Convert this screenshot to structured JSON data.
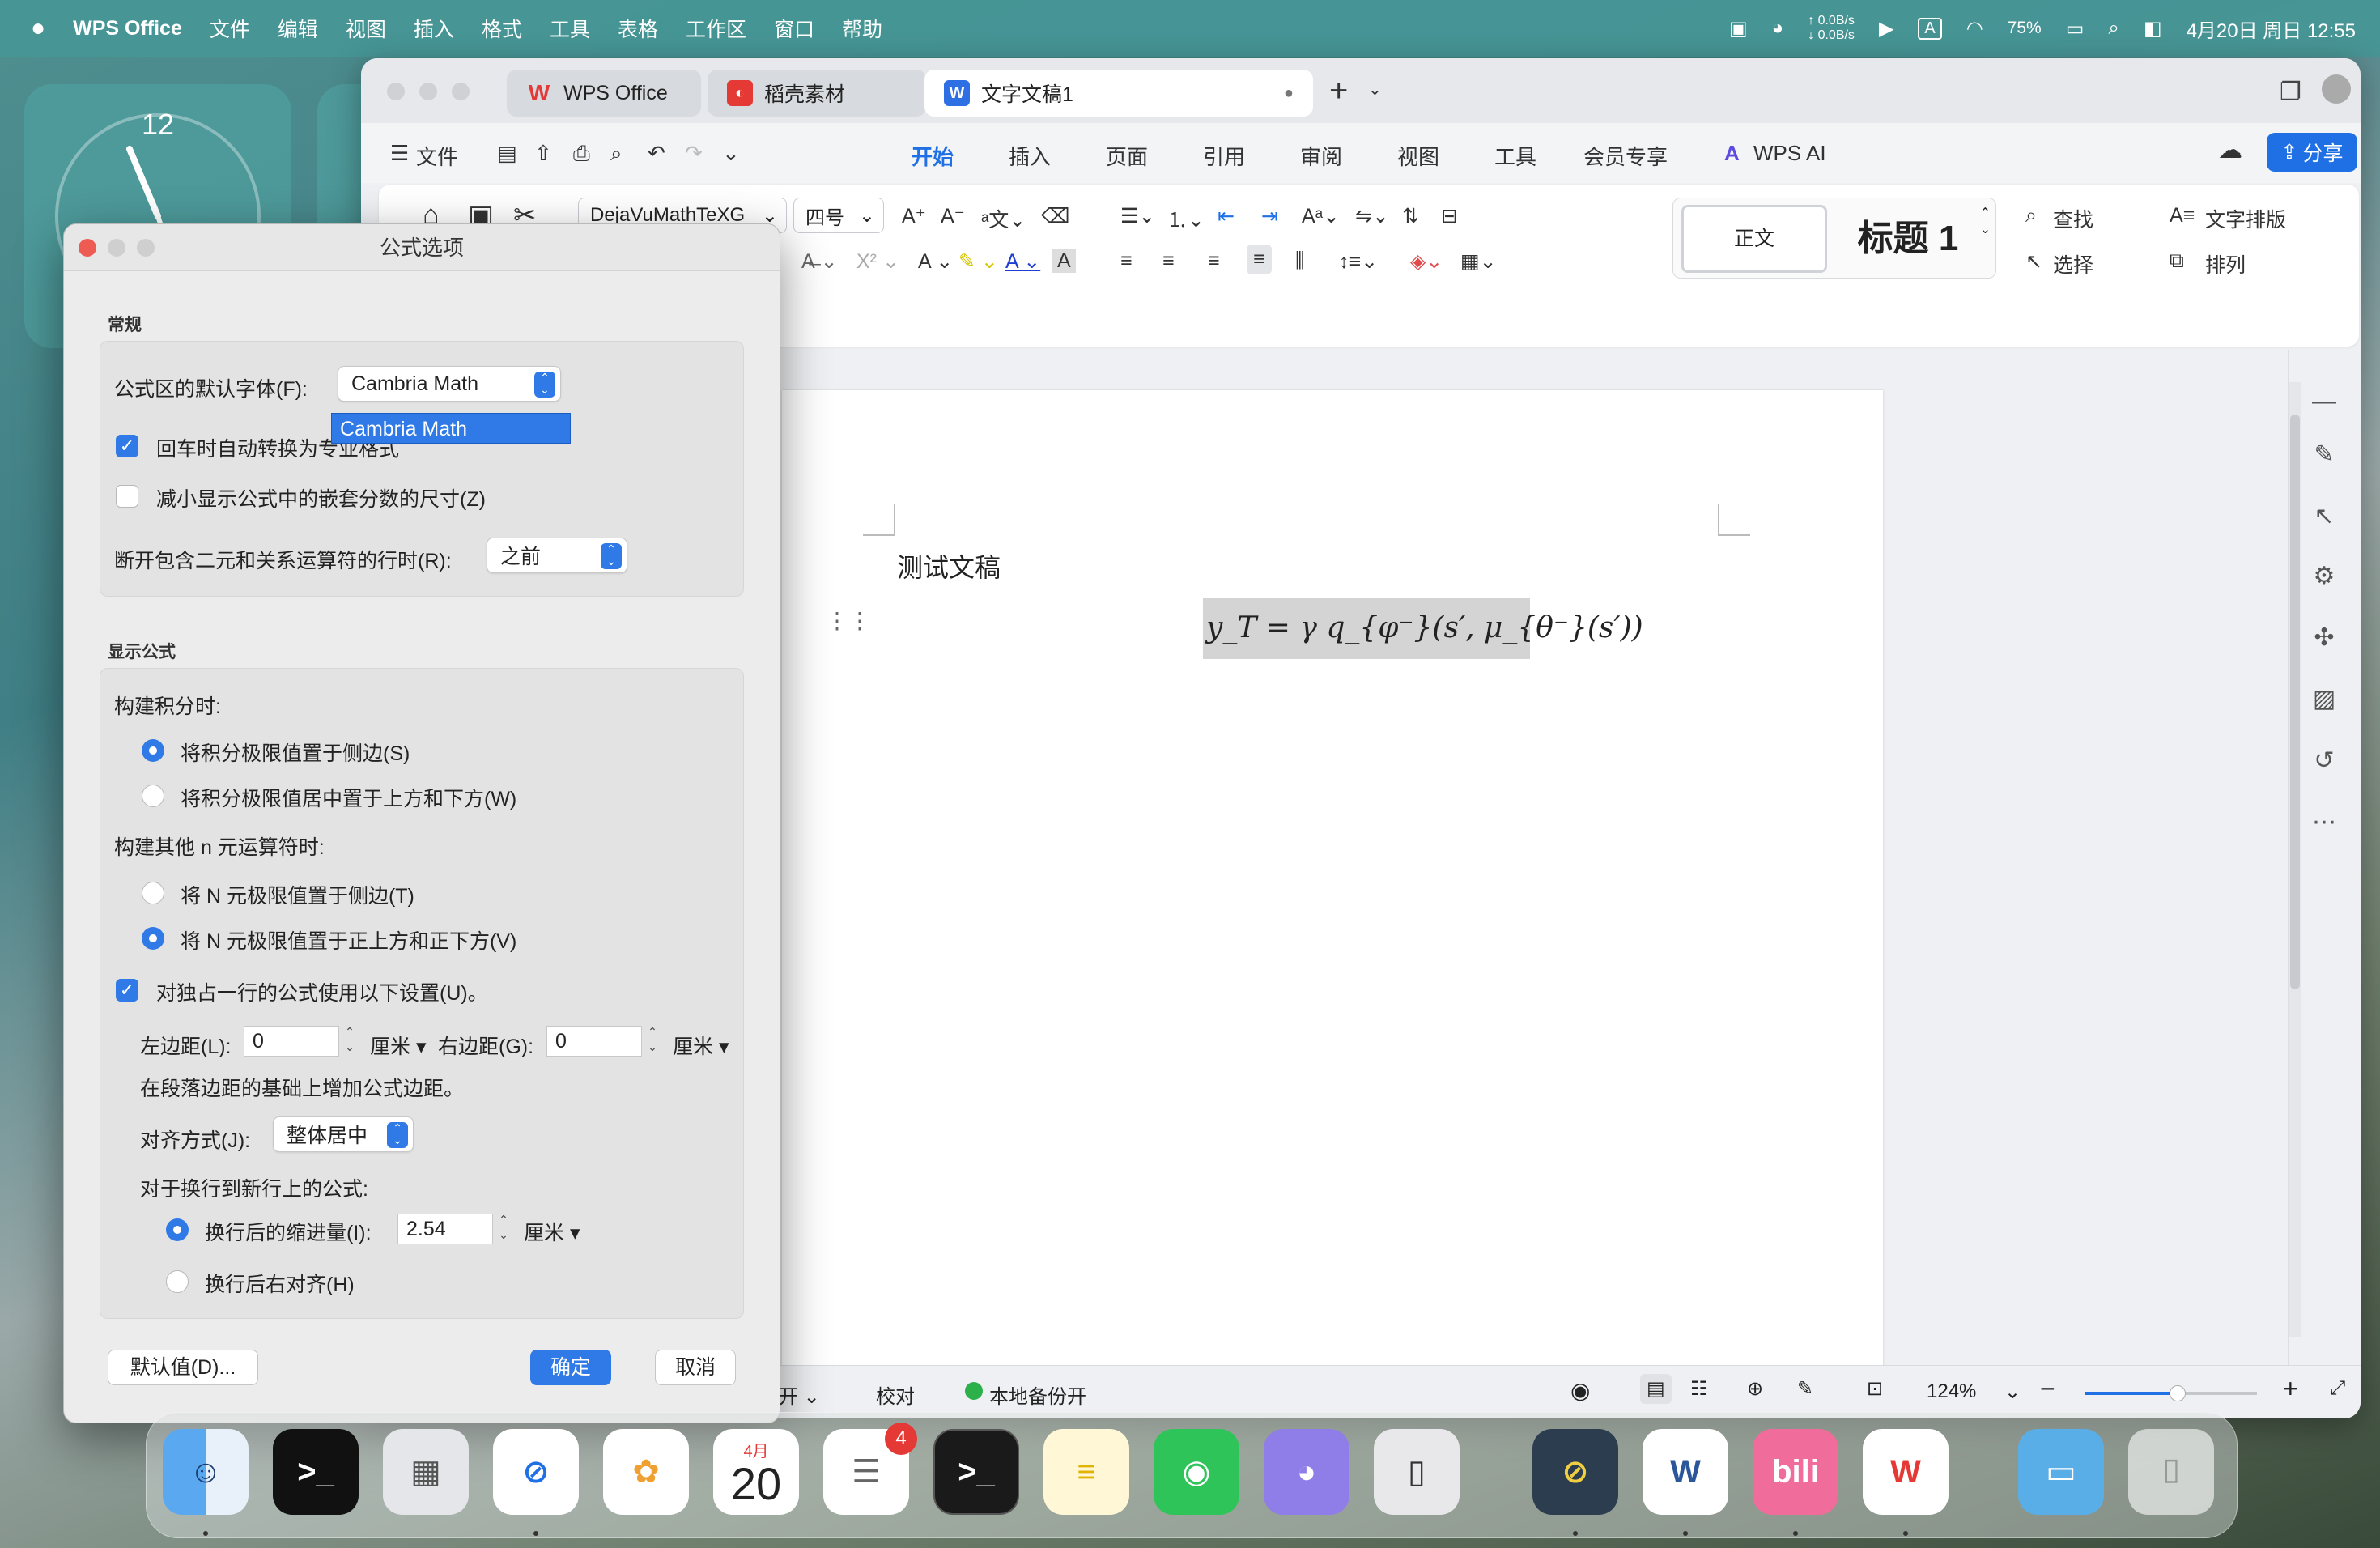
{
  "menubar": {
    "app": "WPS Office",
    "items": [
      "文件",
      "编辑",
      "视图",
      "插入",
      "格式",
      "工具",
      "表格",
      "工作区",
      "窗口",
      "帮助"
    ],
    "net_up": "↑ 0.0B/s",
    "net_down": "↓ 0.0B/s",
    "battery": "75%",
    "datetime": "4月20日 周日 12:55"
  },
  "tabs": [
    {
      "label": "WPS Office"
    },
    {
      "label": "稻壳素材"
    },
    {
      "label": "文字文稿1"
    }
  ],
  "menu_row": {
    "file": "文件",
    "ribbon_tabs": [
      "开始",
      "插入",
      "页面",
      "引用",
      "审阅",
      "视图",
      "工具",
      "会员专享"
    ],
    "wps_ai": "WPS AI",
    "share": "分享"
  },
  "ribbon": {
    "font": "DejaVuMathTeXG",
    "size": "四号",
    "style_normal": "正文",
    "style_heading": "标题 1",
    "find": "查找",
    "select": "选择",
    "text_layout": "文字排版",
    "arrange": "排列"
  },
  "document": {
    "title": "测试文稿",
    "formula": "y_T = γ q_{φ⁻}(s′, μ_{θ⁻}(s′))"
  },
  "statusbar": {
    "left_partial": "开",
    "proofread": "校对",
    "backup": "本地备份开",
    "zoom": "124%"
  },
  "dialog": {
    "title": "公式选项",
    "section_general": "常规",
    "default_font_label": "公式区的默认字体(F):",
    "default_font_value": "Cambria Math",
    "dropdown_option": "Cambria Math",
    "auto_convert": "回车时自动转换为专业格式",
    "reduce_size": "减小显示公式中的嵌套分数的尺寸(Z)",
    "break_label": "断开包含二元和关系运算符的行时(R):",
    "break_value": "之前",
    "section_display": "显示公式",
    "integral_label": "构建积分时:",
    "integral_side": "将积分极限值置于侧边(S)",
    "integral_center": "将积分极限值居中置于上方和下方(W)",
    "nary_label": "构建其他 n 元运算符时:",
    "nary_side": "将 N 元极限值置于侧边(T)",
    "nary_above": "将 N 元极限值置于正上方和正下方(V)",
    "own_line": "对独占一行的公式使用以下设置(U)。",
    "left_margin_label": "左边距(L):",
    "left_margin_value": "0",
    "unit": "厘米",
    "right_margin_label": "右边距(G):",
    "right_margin_value": "0",
    "margin_note": "在段落边距的基础上增加公式边距。",
    "align_label": "对齐方式(J):",
    "align_value": "整体居中",
    "wrap_label": "对于换行到新行上的公式:",
    "indent_label": "换行后的缩进量(I):",
    "indent_value": "2.54",
    "right_align": "换行后右对齐(H)",
    "default_btn": "默认值(D)...",
    "ok_btn": "确定",
    "cancel_btn": "取消"
  },
  "dock": {
    "calendar_month": "4月",
    "calendar_day": "20",
    "reminders_badge": "4"
  }
}
